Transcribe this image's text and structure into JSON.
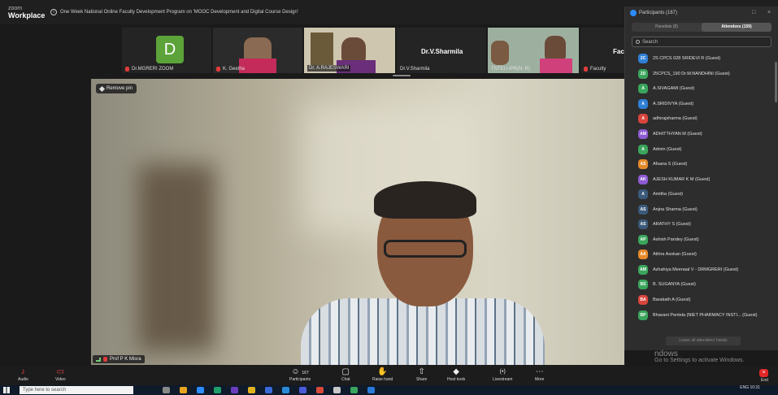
{
  "app": {
    "brand_top": "zoom",
    "brand_bottom": "Workplace",
    "meeting_info": "One Week National Online Faculty Development Program on 'MOOC Development and Digital Course Design'"
  },
  "thumbnails": [
    {
      "name": "Dr.MGRERI ZOOM",
      "avatar": "D",
      "avatar_color": "#5ca43a",
      "muted": true
    },
    {
      "name": "K. Geetha",
      "muted": true
    },
    {
      "name": "Dr. A.RAJESWARI",
      "muted": false
    },
    {
      "name": "Dr.V.Sharmila",
      "big_name": "Dr.V.Sharmila",
      "muted": false
    },
    {
      "name": "TNTEU-IPR(N. R)",
      "muted": false
    },
    {
      "name": "Faculty",
      "big_name": "Facu",
      "muted": true
    }
  ],
  "main_video": {
    "remove_pin": "Remove pin",
    "speaker": "Prof P K Misra"
  },
  "participants": {
    "title": "Participants (167)",
    "tab_panelists": "Panelists (8)",
    "tab_attendees": "Attendees (159)",
    "search_placeholder": "Search",
    "lower_hands": "Lower all attendees' hands",
    "list": [
      {
        "initials": "2C",
        "color": "#2f7fd6",
        "name": "2S  CPCS 028 SRIDEVI R (Guest)"
      },
      {
        "initials": "2D",
        "color": "#3aa55c",
        "name": "25CPCS_190 Dr.M.NANDHINI (Guest)"
      },
      {
        "initials": "A",
        "color": "#3aa55c",
        "name": "A.SIVAGAMI (Guest)"
      },
      {
        "initials": "A",
        "color": "#2f7fd6",
        "name": "A.SRIDIVYA (Guest)"
      },
      {
        "initials": "A",
        "color": "#d9453d",
        "name": "adhirajsharma (Guest)"
      },
      {
        "initials": "AM",
        "color": "#8c5ad1",
        "name": "ADHITTHYAN M (Guest)"
      },
      {
        "initials": "A",
        "color": "#3aa55c",
        "name": "Admin (Guest)"
      },
      {
        "initials": "AS",
        "color": "#e58a2a",
        "name": "Afsana S (Guest)"
      },
      {
        "initials": "AK",
        "color": "#8c5ad1",
        "name": "AJESH KUMAR K M (Guest)"
      },
      {
        "initials": "A",
        "color": "#3b5a7a",
        "name": "Amitha (Guest)"
      },
      {
        "initials": "AS",
        "color": "#3b5a7a",
        "name": "Anjna Sharma (Guest)"
      },
      {
        "initials": "AS",
        "color": "#3b5a7a",
        "name": "ARATHY S (Guest)"
      },
      {
        "initials": "AP",
        "color": "#3aa55c",
        "name": "Ashish Pandey (Guest)"
      },
      {
        "initials": "AA",
        "color": "#e58a2a",
        "name": "Athira Asokan (Guest)"
      },
      {
        "initials": "AM",
        "color": "#3aa55c",
        "name": "Azhahiya Meenaal V - DRMGRERI (Guest)"
      },
      {
        "initials": "BS",
        "color": "#3aa55c",
        "name": "B. SUGANYA (Guest)"
      },
      {
        "initials": "BA",
        "color": "#d9453d",
        "name": "Barakath A (Guest)"
      },
      {
        "initials": "BP",
        "color": "#3aa55c",
        "name": "Bhavani Pentela (NIET PHARMACY INSTI... (Guest)"
      }
    ]
  },
  "watermark": {
    "line1": "ndows",
    "line2": "Go to Settings to activate Windows."
  },
  "toolbar": {
    "audio": "Audio",
    "video": "Video",
    "participants": "Participants",
    "participants_count": "167",
    "chat": "Chat",
    "raise_hand": "Raise hand",
    "share": "Share",
    "host_tools": "Host tools",
    "livestream": "Livestream",
    "more": "More",
    "end": "End"
  },
  "taskbar": {
    "search_placeholder": "Type here to search",
    "lang": "ENG",
    "time": "10:31"
  }
}
